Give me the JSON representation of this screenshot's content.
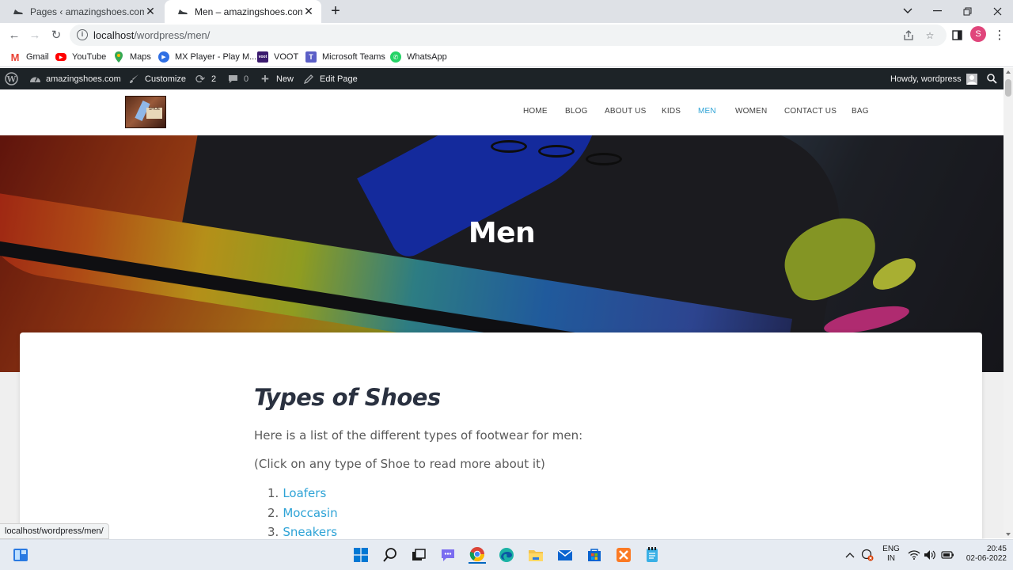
{
  "browser": {
    "tabs": [
      {
        "title": "Pages ‹ amazingshoes.com — W",
        "active": false
      },
      {
        "title": "Men – amazingshoes.com",
        "active": true
      }
    ],
    "url_host": "localhost",
    "url_path": "/wordpress/men/",
    "profile_initial": "S",
    "bookmarks": [
      {
        "label": "Gmail",
        "icon": "gmail-icon",
        "color": "#ea4335"
      },
      {
        "label": "YouTube",
        "icon": "youtube-icon",
        "color": "#ff0000"
      },
      {
        "label": "Maps",
        "icon": "maps-icon",
        "color": "#34a853"
      },
      {
        "label": "MX Player - Play M...",
        "icon": "mx-player-icon",
        "color": "#2f6fe4"
      },
      {
        "label": "VOOT",
        "icon": "voot-icon",
        "color": "#3a1a6e"
      },
      {
        "label": "Microsoft Teams",
        "icon": "teams-icon",
        "color": "#5b5fc7"
      },
      {
        "label": "WhatsApp",
        "icon": "whatsapp-icon",
        "color": "#25d366"
      }
    ],
    "status_url": "localhost/wordpress/men/"
  },
  "wp_admin_bar": {
    "site_name": "amazingshoes.com",
    "customize": "Customize",
    "updates_count": "2",
    "comments_count": "0",
    "new_label": "New",
    "edit_page": "Edit Page",
    "howdy": "Howdy, wordpress"
  },
  "site": {
    "menu": [
      "HOME",
      "BLOG",
      "ABOUT US",
      "KIDS",
      "MEN",
      "WOMEN",
      "CONTACT US",
      "BAG"
    ],
    "active_menu": "MEN",
    "accent": "#2ea3d6",
    "hero_title": "Men",
    "heading": "Types of Shoes",
    "intro": "Here is a list of the different types of footwear for men:",
    "note": "(Click on any type of Shoe to read more about it)",
    "list": [
      {
        "num": "1.",
        "label": "Loafers"
      },
      {
        "num": "2.",
        "label": "Moccasin"
      },
      {
        "num": "3.",
        "label": "Sneakers"
      }
    ]
  },
  "taskbar": {
    "lang_line1": "ENG",
    "lang_line2": "IN",
    "time": "20:45",
    "date": "02-06-2022"
  }
}
